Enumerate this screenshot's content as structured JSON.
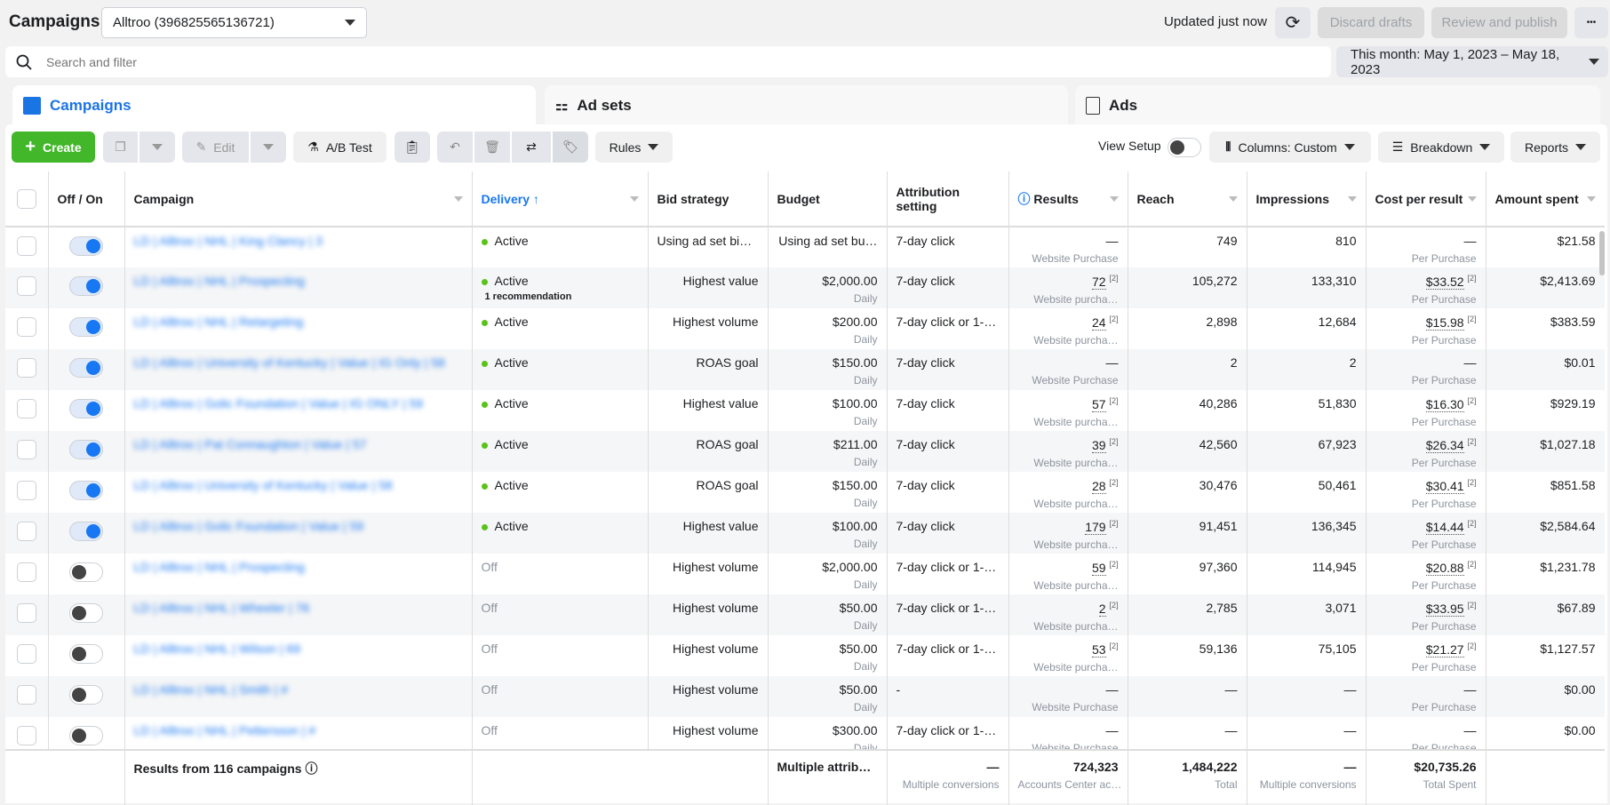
{
  "header": {
    "title": "Campaigns",
    "account": "Alltroo (396825565136721)",
    "updated": "Updated just now",
    "discard": "Discard drafts",
    "review": "Review and publish",
    "more": "•••"
  },
  "search": {
    "placeholder": "Search and filter",
    "date_range": "This month: May 1, 2023 – May 18, 2023"
  },
  "tabs": [
    {
      "label": "Campaigns",
      "icon": "folder-icon"
    },
    {
      "label": "Ad sets",
      "icon": "grid-icon"
    },
    {
      "label": "Ads",
      "icon": "ad-icon"
    }
  ],
  "toolbar": {
    "create": "Create",
    "edit": "Edit",
    "ab_test": "A/B Test",
    "rules": "Rules",
    "view_setup": "View Setup",
    "columns": "Columns: Custom",
    "breakdown": "Breakdown",
    "reports": "Reports"
  },
  "colors": {
    "accent": "#1877f2",
    "create": "#42b72a",
    "active": "#5ac21a"
  },
  "columns": [
    "Off / On",
    "Campaign",
    "Delivery ↑",
    "Bid strategy",
    "Budget",
    "Attribution setting",
    "Results",
    "Reach",
    "Impressions",
    "Cost per result",
    "Amount spent"
  ],
  "rows": [
    {
      "on": true,
      "name": "LD | Alltroo | NHL | King Clancy | 3",
      "delivery": "Active",
      "rec": "",
      "bid": "Using ad set bid…",
      "budget": "Using ad set bu…",
      "budget_sub": "",
      "attr": "7-day click",
      "result": "—",
      "rsup": "",
      "rsub": "Website Purchase",
      "reach": "749",
      "impr": "810",
      "cpr": "—",
      "csup": "",
      "csub": "Per Purchase",
      "spent": "$21.58"
    },
    {
      "on": true,
      "name": "LD | Alltroo | NHL | Prospecting",
      "delivery": "Active",
      "rec": "1 recommendation",
      "bid": "Highest value",
      "budget": "$2,000.00",
      "budget_sub": "Daily",
      "attr": "7-day click",
      "result": "72",
      "rsup": "[2]",
      "rsub": "Website purcha…",
      "reach": "105,272",
      "impr": "133,310",
      "cpr": "$33.52",
      "csup": "[2]",
      "csub": "Per Purchase",
      "spent": "$2,413.69"
    },
    {
      "on": true,
      "name": "LD | Alltroo | NHL | Retargeting",
      "delivery": "Active",
      "rec": "",
      "bid": "Highest volume",
      "budget": "$200.00",
      "budget_sub": "Daily",
      "attr": "7-day click or 1-…",
      "result": "24",
      "rsup": "[2]",
      "rsub": "Website purcha…",
      "reach": "2,898",
      "impr": "12,684",
      "cpr": "$15.98",
      "csup": "[2]",
      "csub": "Per Purchase",
      "spent": "$383.59"
    },
    {
      "on": true,
      "name": "LD | Alltroo | University of Kentucky | Value | IG Only | 58",
      "delivery": "Active",
      "rec": "",
      "bid": "ROAS goal",
      "budget": "$150.00",
      "budget_sub": "Daily",
      "attr": "7-day click",
      "result": "—",
      "rsup": "",
      "rsub": "Website Purchase",
      "reach": "2",
      "impr": "2",
      "cpr": "—",
      "csup": "",
      "csub": "Per Purchase",
      "spent": "$0.01"
    },
    {
      "on": true,
      "name": "LD | Alltroo | Golic Foundation | Value | IG ONLY | 59",
      "delivery": "Active",
      "rec": "",
      "bid": "Highest value",
      "budget": "$100.00",
      "budget_sub": "Daily",
      "attr": "7-day click",
      "result": "57",
      "rsup": "[2]",
      "rsub": "Website purcha…",
      "reach": "40,286",
      "impr": "51,830",
      "cpr": "$16.30",
      "csup": "[2]",
      "csub": "Per Purchase",
      "spent": "$929.19"
    },
    {
      "on": true,
      "name": "LD | Alltroo | Pat Connaughton | Value | 57",
      "delivery": "Active",
      "rec": "",
      "bid": "ROAS goal",
      "budget": "$211.00",
      "budget_sub": "Daily",
      "attr": "7-day click",
      "result": "39",
      "rsup": "[2]",
      "rsub": "Website purcha…",
      "reach": "42,560",
      "impr": "67,923",
      "cpr": "$26.34",
      "csup": "[2]",
      "csub": "Per Purchase",
      "spent": "$1,027.18"
    },
    {
      "on": true,
      "name": "LD | Alltroo | University of Kentucky | Value | 58",
      "delivery": "Active",
      "rec": "",
      "bid": "ROAS goal",
      "budget": "$150.00",
      "budget_sub": "Daily",
      "attr": "7-day click",
      "result": "28",
      "rsup": "[2]",
      "rsub": "Website purcha…",
      "reach": "30,476",
      "impr": "50,461",
      "cpr": "$30.41",
      "csup": "[2]",
      "csub": "Per Purchase",
      "spent": "$851.58"
    },
    {
      "on": true,
      "name": "LD | Alltroo | Golic Foundation | Value | 59",
      "delivery": "Active",
      "rec": "",
      "bid": "Highest value",
      "budget": "$100.00",
      "budget_sub": "Daily",
      "attr": "7-day click",
      "result": "179",
      "rsup": "[2]",
      "rsub": "Website purcha…",
      "reach": "91,451",
      "impr": "136,345",
      "cpr": "$14.44",
      "csup": "[2]",
      "csub": "Per Purchase",
      "spent": "$2,584.64"
    },
    {
      "on": false,
      "name": "LD | Alltroo | NHL | Prospecting",
      "delivery": "Off",
      "rec": "",
      "bid": "Highest volume",
      "budget": "$2,000.00",
      "budget_sub": "Daily",
      "attr": "7-day click or 1-…",
      "result": "59",
      "rsup": "[2]",
      "rsub": "Website purcha…",
      "reach": "97,360",
      "impr": "114,945",
      "cpr": "$20.88",
      "csup": "[2]",
      "csub": "Per Purchase",
      "spent": "$1,231.78"
    },
    {
      "on": false,
      "name": "LD | Alltroo | NHL | Wheeler | 76",
      "delivery": "Off",
      "rec": "",
      "bid": "Highest volume",
      "budget": "$50.00",
      "budget_sub": "Daily",
      "attr": "7-day click or 1-…",
      "result": "2",
      "rsup": "[2]",
      "rsub": "Website purcha…",
      "reach": "2,785",
      "impr": "3,071",
      "cpr": "$33.95",
      "csup": "[2]",
      "csub": "Per Purchase",
      "spent": "$67.89"
    },
    {
      "on": false,
      "name": "LD | Alltroo | NHL | Wilson | 69",
      "delivery": "Off",
      "rec": "",
      "bid": "Highest volume",
      "budget": "$50.00",
      "budget_sub": "Daily",
      "attr": "7-day click or 1-…",
      "result": "53",
      "rsup": "[2]",
      "rsub": "Website purcha…",
      "reach": "59,136",
      "impr": "75,105",
      "cpr": "$21.27",
      "csup": "[2]",
      "csub": "Per Purchase",
      "spent": "$1,127.57"
    },
    {
      "on": false,
      "name": "LD | Alltroo | NHL | Smith | #",
      "delivery": "Off",
      "rec": "",
      "bid": "Highest volume",
      "budget": "$50.00",
      "budget_sub": "Daily",
      "attr": "-",
      "result": "—",
      "rsup": "",
      "rsub": "Website Purchase",
      "reach": "—",
      "impr": "—",
      "cpr": "—",
      "csup": "",
      "csub": "Per Purchase",
      "spent": "$0.00"
    },
    {
      "on": false,
      "name": "LD | Alltroo | NHL | Pettersson | #",
      "delivery": "Off",
      "rec": "",
      "bid": "Highest volume",
      "budget": "$300.00",
      "budget_sub": "Daily",
      "attr": "7-day click or 1-…",
      "result": "—",
      "rsup": "",
      "rsub": "Website Purchase",
      "reach": "—",
      "impr": "—",
      "cpr": "—",
      "csup": "",
      "csub": "Per Purchase",
      "spent": "$0.00"
    }
  ],
  "footer": {
    "label": "Results from 116 campaigns",
    "attr": "Multiple attributi…",
    "result": "—",
    "result_sub": "Multiple conversions",
    "reach": "724,323",
    "reach_sub": "Accounts Center ac…",
    "impr": "1,484,222",
    "impr_sub": "Total",
    "cpr": "—",
    "cpr_sub": "Multiple conversions",
    "spent": "$20,735.26",
    "spent_sub": "Total Spent"
  }
}
